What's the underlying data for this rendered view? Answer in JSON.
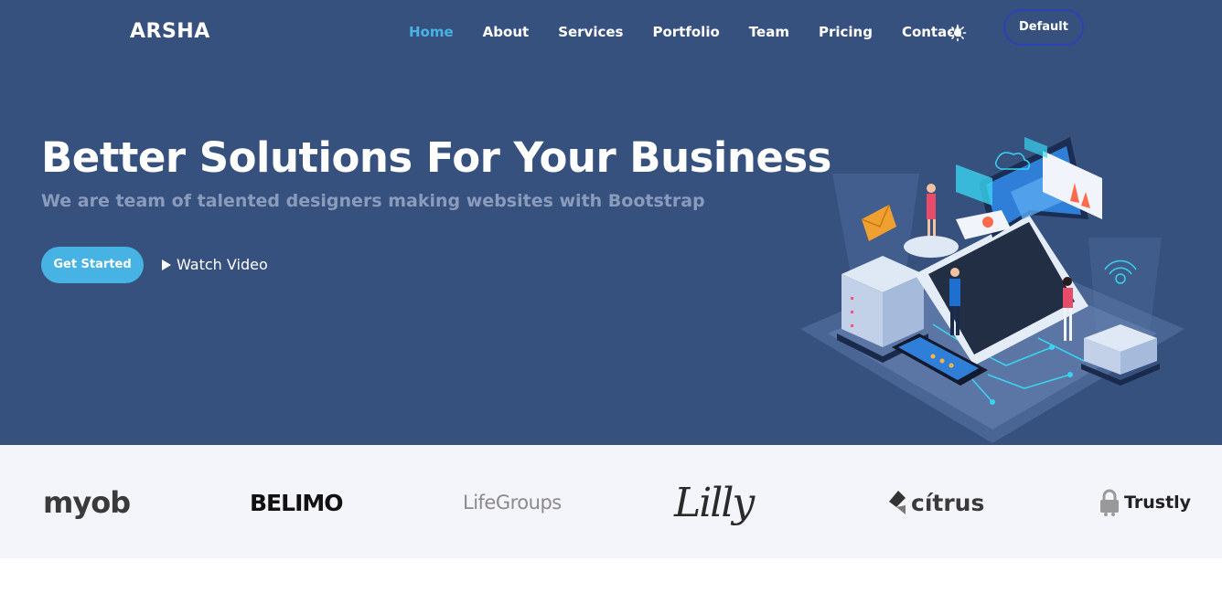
{
  "header": {
    "logo": "ARSHA",
    "nav": [
      {
        "label": "Home",
        "active": true
      },
      {
        "label": "About"
      },
      {
        "label": "Services"
      },
      {
        "label": "Portfolio"
      },
      {
        "label": "Team"
      },
      {
        "label": "Pricing"
      },
      {
        "label": "Contact"
      }
    ],
    "theme_icon": "sun-icon",
    "theme_button": "Default"
  },
  "hero": {
    "title": "Better Solutions For Your Business",
    "subtitle": "We are team of talented designers making websites with Bootstrap",
    "cta_primary": "Get Started",
    "cta_secondary": "Watch Video",
    "illustration": "isometric-laptop-servers-illustration"
  },
  "clients": [
    "myob",
    "BELIMO",
    "LifeGroups",
    "Lilly",
    "cítrus",
    "Trustly"
  ],
  "colors": {
    "hero_bg": "#37517e",
    "accent": "#47b2e4",
    "clients_bg": "#f3f5fa",
    "theme_button_border": "#2c42b4"
  }
}
